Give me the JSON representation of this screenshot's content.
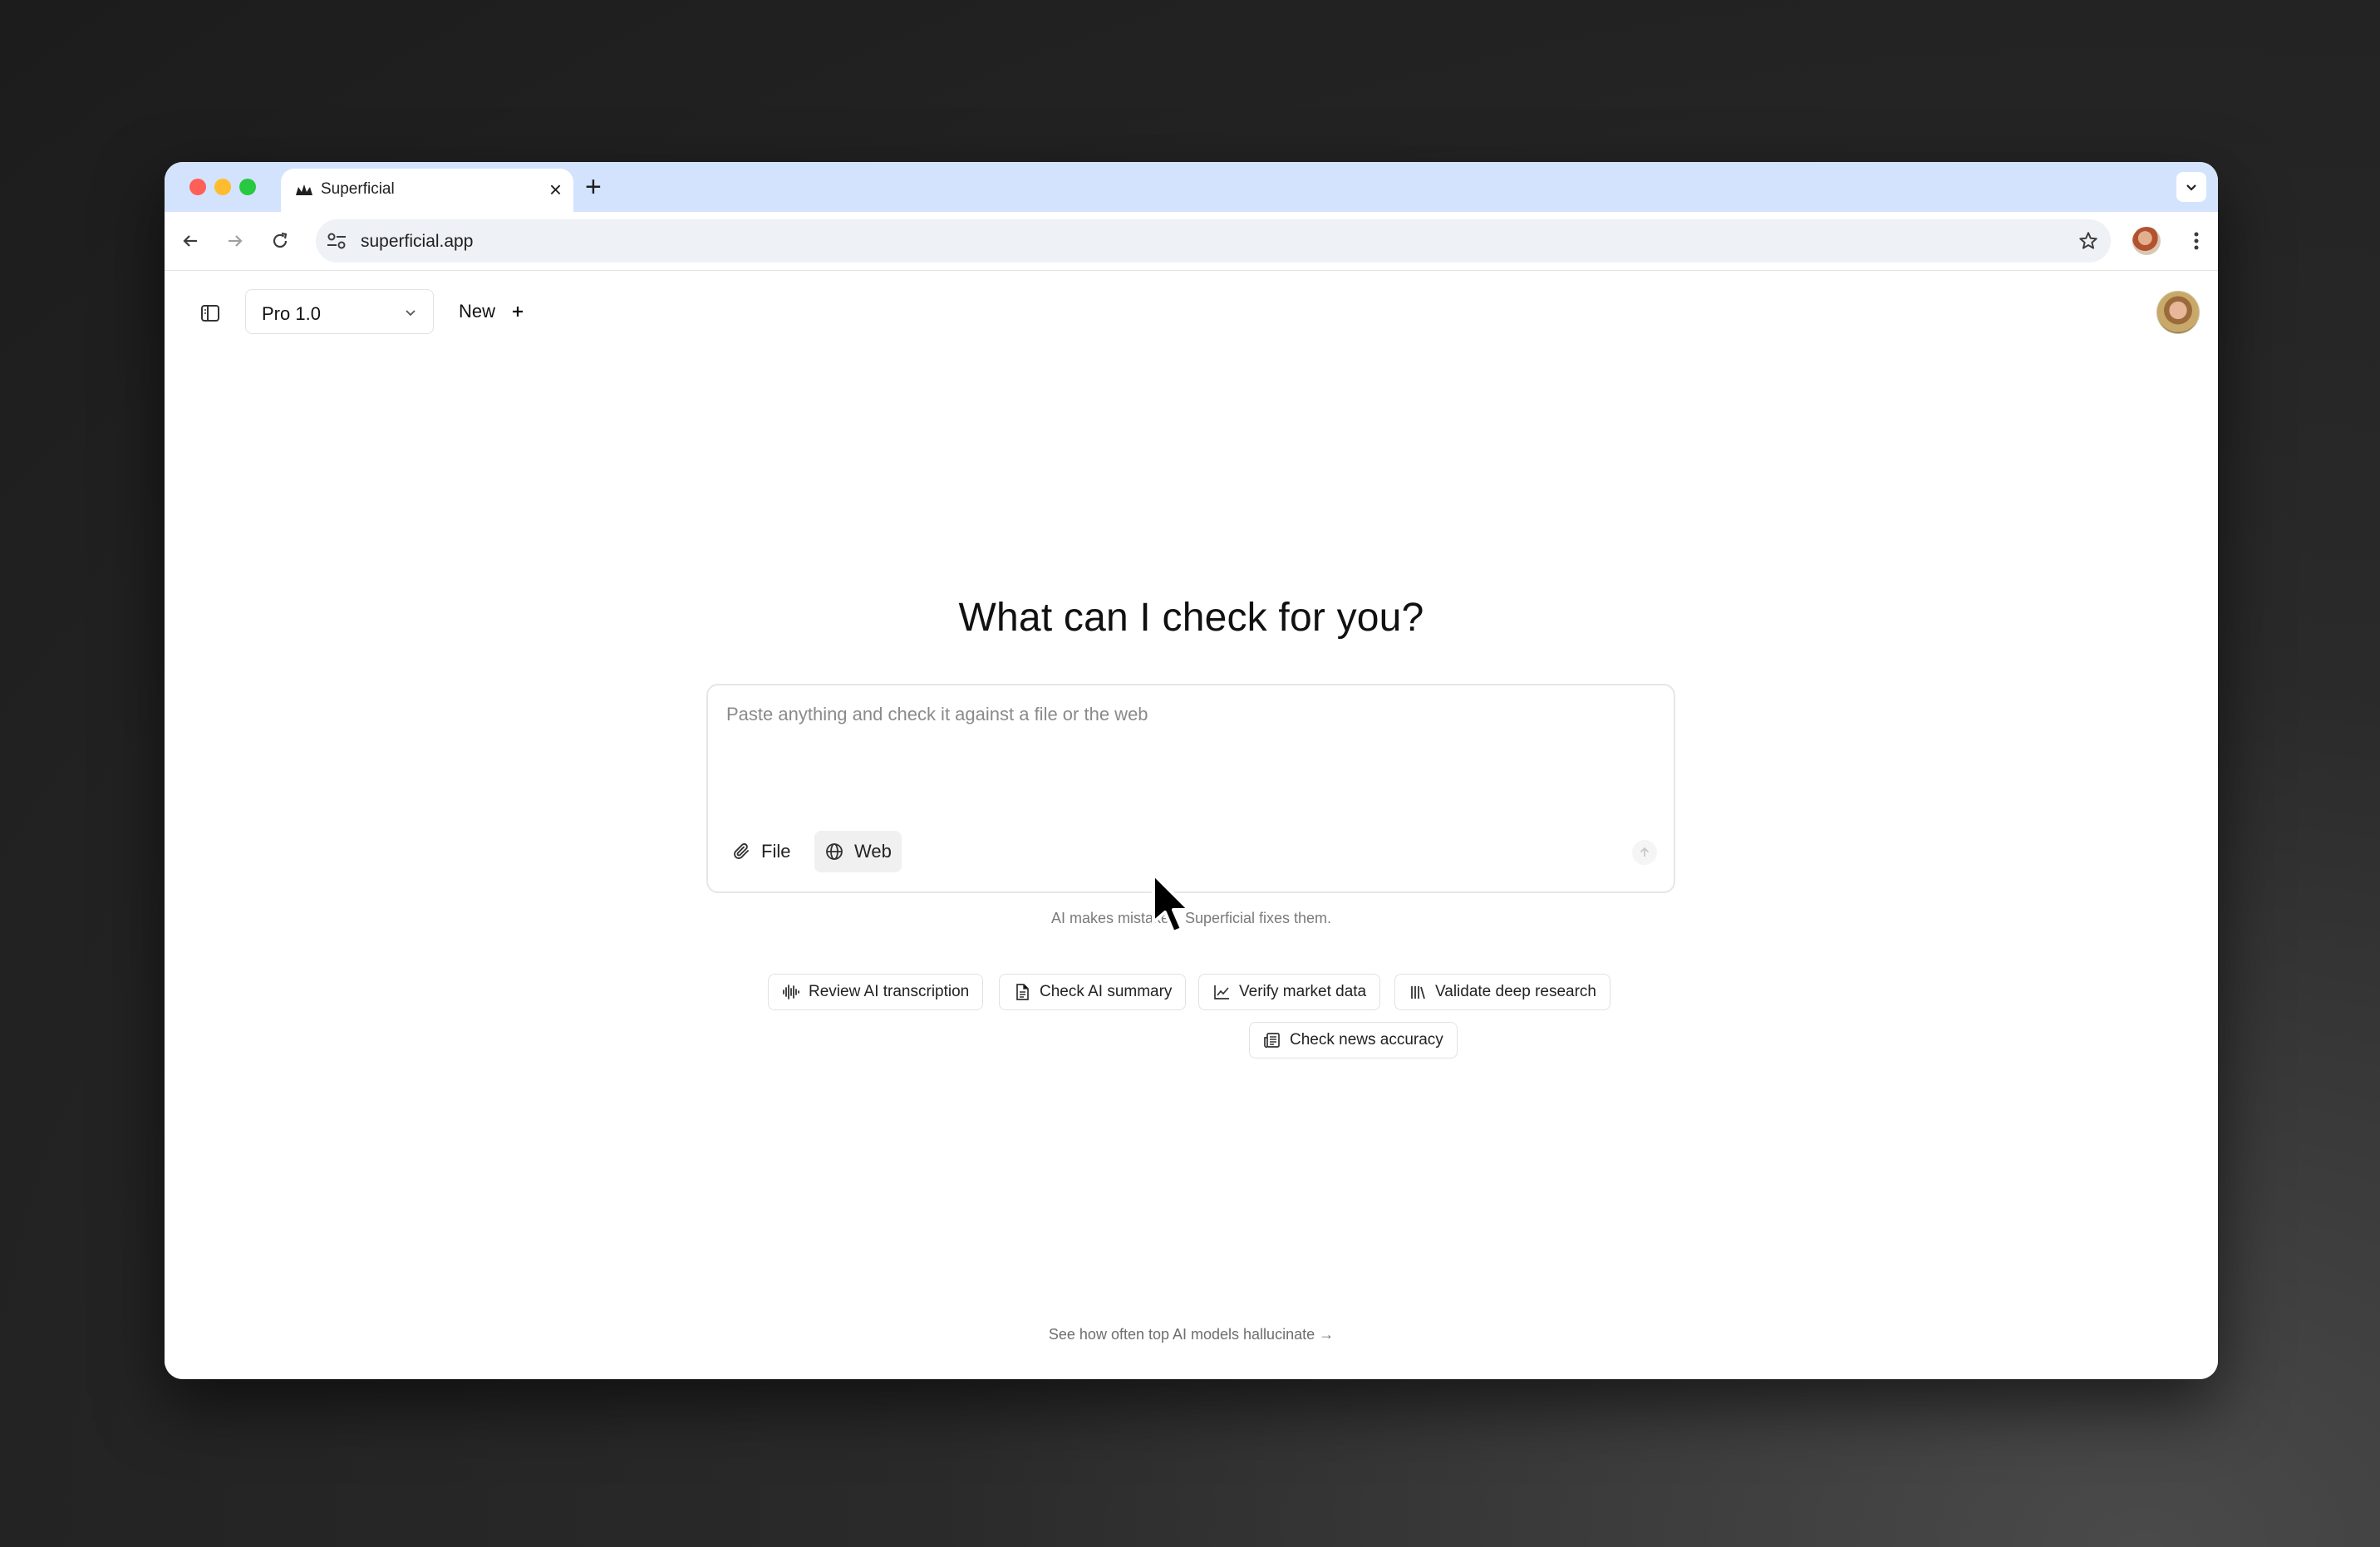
{
  "browser": {
    "tab": {
      "title": "Superficial",
      "favicon": "superficial-logo-icon",
      "close_icon": "close-icon"
    },
    "new_tab_icon": "plus-icon",
    "tab_dropdown_icon": "chevron-down-icon",
    "nav": {
      "back_icon": "arrow-left-icon",
      "forward_icon": "arrow-right-icon",
      "reload_icon": "reload-icon"
    },
    "omnibox": {
      "url": "superficial.app",
      "site_info_icon": "tune-icon",
      "bookmark_icon": "star-icon"
    },
    "menu_icon": "kebab-icon",
    "traffic_lights": {
      "close": "#ff5f57",
      "minimize": "#febc2e",
      "maximize": "#28c840"
    }
  },
  "app": {
    "sidebar_toggle_icon": "sidebar-icon",
    "model_select": {
      "value": "Pro 1.0",
      "icon": "chevron-down-icon"
    },
    "new_button": {
      "label": "New",
      "icon": "plus-icon"
    },
    "heading": "What can I check for you?",
    "composer": {
      "placeholder": "Paste anything and check it against a file or the web",
      "file_label": "File",
      "web_label": "Web",
      "send_icon": "arrow-up-icon"
    },
    "disclaimer": "AI makes mistakes. Superficial fixes them.",
    "suggestions": [
      {
        "label": "Review AI transcription",
        "icon": "waveform-icon"
      },
      {
        "label": "Check AI summary",
        "icon": "document-icon"
      },
      {
        "label": "Verify market data",
        "icon": "line-chart-icon"
      },
      {
        "label": "Validate deep research",
        "icon": "library-icon"
      },
      {
        "label": "Check news accuracy",
        "icon": "newspaper-icon"
      }
    ],
    "footer_link": "See how often top AI models hallucinate →"
  }
}
